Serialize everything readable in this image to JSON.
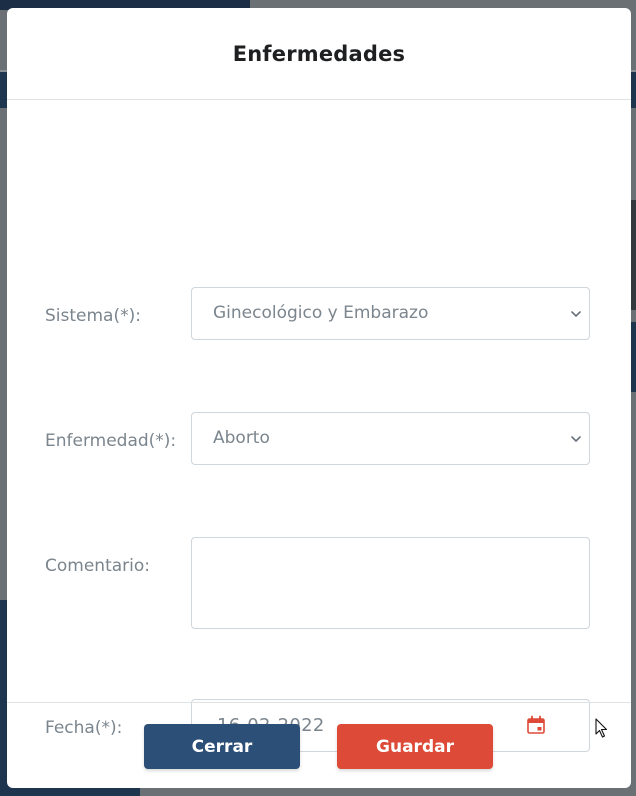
{
  "modal": {
    "title": "Enfermedades",
    "fields": {
      "sistema": {
        "label": "Sistema(*):",
        "value": "Ginecológico y Embarazo"
      },
      "enfermedad": {
        "label": "Enfermedad(*):",
        "value": "Aborto"
      },
      "comentario": {
        "label": "Comentario:",
        "value": ""
      },
      "fecha": {
        "label": "Fecha(*):",
        "value": "16-02-2022"
      }
    },
    "buttons": {
      "close_label": "Cerrar",
      "save_label": "Guardar"
    }
  },
  "colors": {
    "primary": "#2c4f77",
    "danger": "#dd4a37",
    "label": "#7b858d",
    "calendar_icon": "#dd4a37"
  },
  "icons": {
    "select_arrow": "chevron-down-icon",
    "date_picker": "calendar-icon"
  }
}
